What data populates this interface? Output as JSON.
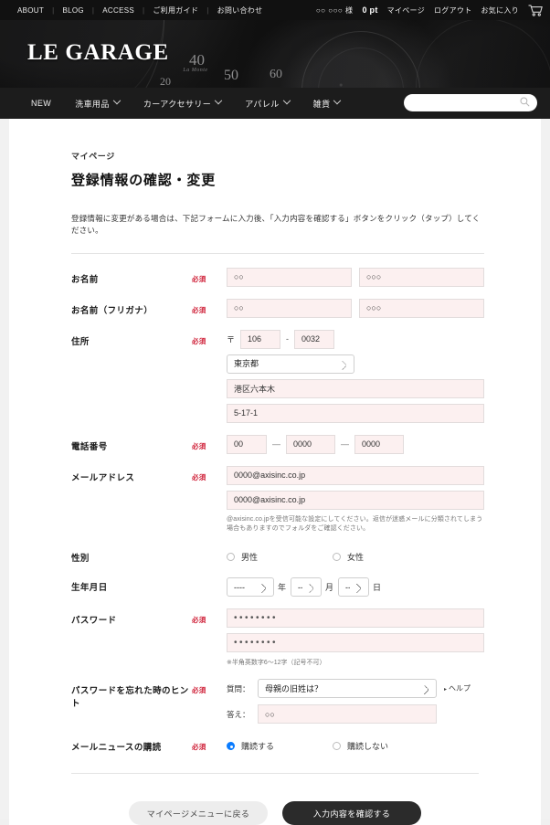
{
  "utility": {
    "links": [
      "ABOUT",
      "BLOG",
      "ACCESS",
      "ご利用ガイド",
      "お問い合わせ"
    ],
    "separator": "|",
    "user_name": "○○ ○○○ 様",
    "points": "0 pt",
    "mypage": "マイページ",
    "logout": "ログアウト",
    "favorites": "お気に入り",
    "cart_icon": "cart-icon"
  },
  "hero": {
    "logo_le": "L",
    "logo_e": "E",
    "logo_garage": "G",
    "logo_text": "LE GARAGE",
    "gauge_ticks": [
      "20",
      "40",
      "50",
      "60"
    ],
    "gauge_signature": "La Monte"
  },
  "nav": {
    "items": [
      {
        "label": "NEW",
        "has_dropdown": false
      },
      {
        "label": "洗車用品",
        "has_dropdown": true
      },
      {
        "label": "カーアクセサリー",
        "has_dropdown": true
      },
      {
        "label": "アパレル",
        "has_dropdown": true
      },
      {
        "label": "雑貨",
        "has_dropdown": true
      }
    ],
    "search_placeholder": "",
    "search_value": "",
    "search_icon": "search-icon"
  },
  "page": {
    "breadcrumb": "マイページ",
    "title": "登録情報の確認・変更",
    "lead": "登録情報に変更がある場合は、下記フォームに入力後、「入力内容を確認する」ボタンをクリック（タップ）してください。",
    "required_badge": "必須"
  },
  "form": {
    "name": {
      "label": "お名前",
      "last_value": "○○",
      "first_value": "○○○"
    },
    "name_kana": {
      "label": "お名前（フリガナ）",
      "last_value": "○○",
      "first_value": "○○○"
    },
    "address": {
      "label": "住所",
      "zip_mark": "〒",
      "zip1": "106",
      "zip_dash": "-",
      "zip2": "0032",
      "prefecture": "東京都",
      "prefecture_options": [
        "東京都"
      ],
      "city": "港区六本木",
      "street": "5-17-1"
    },
    "tel": {
      "label": "電話番号",
      "part1": "00",
      "part2": "0000",
      "part3": "0000",
      "dash": "—"
    },
    "email": {
      "label": "メールアドレス",
      "value1": "0000@axisinc.co.jp",
      "value2": "0000@axisinc.co.jp",
      "note": "@axisinc.co.jpを受信可能な設定にしてください。返信が迷惑メールに分類されてしまう場合もありますのでフォルダをご確認ください。"
    },
    "gender": {
      "label": "性別",
      "options": [
        {
          "label": "男性",
          "selected": false
        },
        {
          "label": "女性",
          "selected": false
        }
      ]
    },
    "birthday": {
      "label": "生年月日",
      "year": "----",
      "year_unit": "年",
      "month": "--",
      "month_unit": "月",
      "day": "--",
      "day_unit": "日"
    },
    "password": {
      "label": "パスワード",
      "value1": "••••••••",
      "value2": "••••••••",
      "note": "※半角英数字6～12字（記号不可）"
    },
    "hint": {
      "label": "パスワードを忘れた時のヒント",
      "question_label": "質問：",
      "question_value": "母親の旧姓は？",
      "question_options": [
        "母親の旧姓は？"
      ],
      "help_arrow": "▸",
      "help_label": "ヘルプ",
      "answer_label": "答え：",
      "answer_value": "○○"
    },
    "newsletter": {
      "label": "メールニュースの購読",
      "options": [
        {
          "label": "購読する",
          "selected": true
        },
        {
          "label": "購読しない",
          "selected": false
        }
      ]
    }
  },
  "actions": {
    "back_label": "マイページメニューに戻る",
    "submit_label": "入力内容を確認する"
  },
  "colors": {
    "required_red": "#cf1f37",
    "field_pink": "#fcf0f0",
    "radio_blue": "#0a7cff",
    "submit_dark": "#2b2b2b"
  }
}
